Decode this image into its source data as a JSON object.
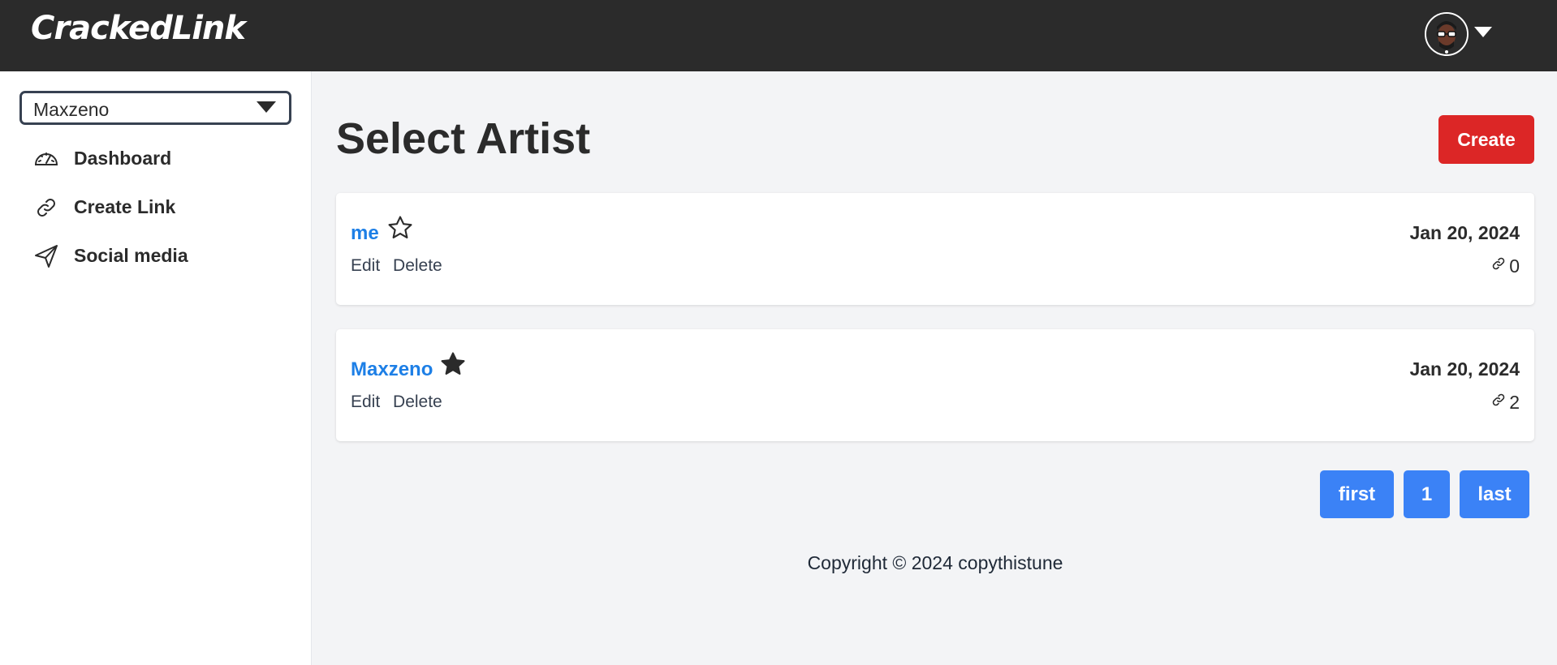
{
  "header": {
    "logo": "CrackedLink",
    "avatar_icon": "user-avatar",
    "menu_icon": "caret-down-icon"
  },
  "sidebar": {
    "artist_select": {
      "value": "Maxzeno"
    },
    "items": [
      {
        "label": "Dashboard",
        "icon": "dashboard-gauge-icon"
      },
      {
        "label": "Create Link",
        "icon": "link-icon"
      },
      {
        "label": "Social media",
        "icon": "send-icon"
      }
    ]
  },
  "main": {
    "title": "Select Artist",
    "create_label": "Create",
    "artists": [
      {
        "name": "me",
        "starred": false,
        "date": "Jan 20, 2024",
        "link_count": "0",
        "edit_label": "Edit",
        "delete_label": "Delete"
      },
      {
        "name": "Maxzeno",
        "starred": true,
        "date": "Jan 20, 2024",
        "link_count": "2",
        "edit_label": "Edit",
        "delete_label": "Delete"
      }
    ],
    "pagination": {
      "first": "first",
      "page": "1",
      "last": "last"
    },
    "footer": "Copyright © 2024 copythistune"
  },
  "colors": {
    "topbar": "#2b2b2b",
    "create_button": "#dc2626",
    "pagination_button": "#3b82f6",
    "artist_link": "#1d7fe6",
    "background": "#f3f4f6"
  }
}
